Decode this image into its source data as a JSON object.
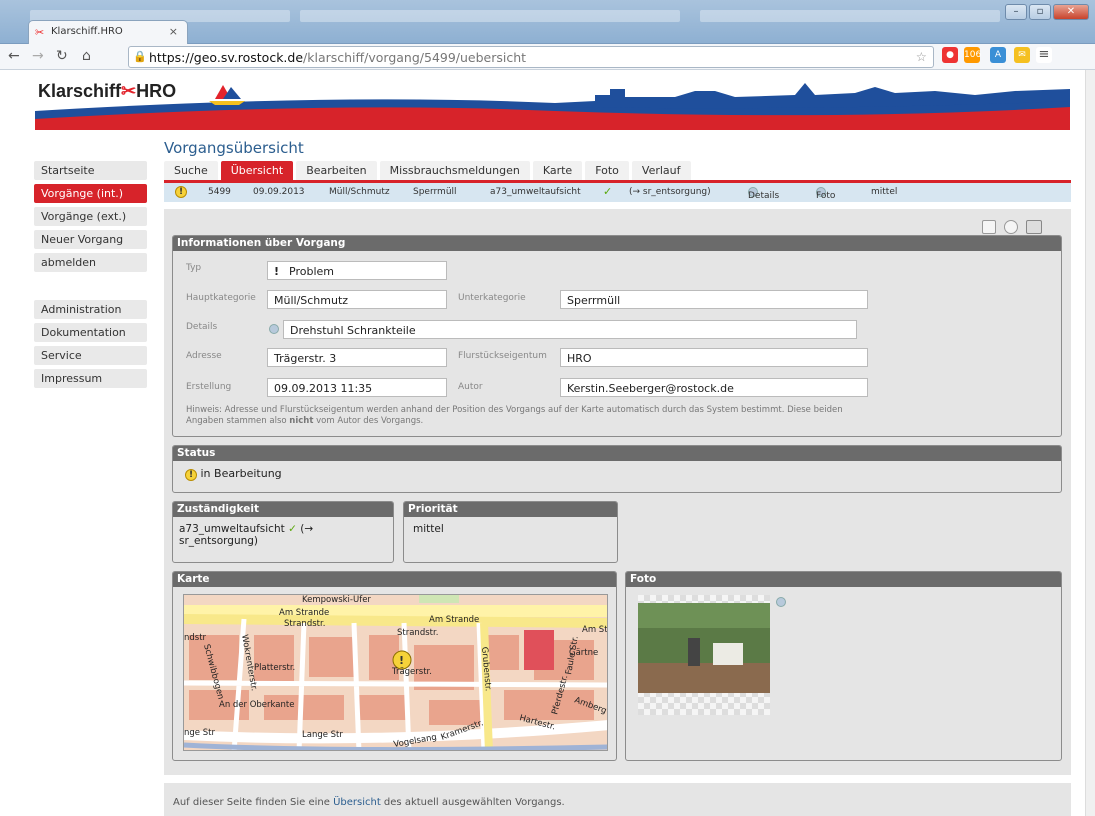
{
  "browser": {
    "tab_title": "Klarschiff.HRO",
    "tab_close": "×",
    "url_host": "https://geo.sv.rostock.de",
    "url_path": "/klarschiff/vorgang/5499/uebersicht",
    "ext_badge": "106"
  },
  "site": {
    "logo_a": "Klarschiff",
    "logo_b": "HRO",
    "page_title": "Vorgangsübersicht"
  },
  "sidebar": {
    "items": [
      {
        "label": "Startseite"
      },
      {
        "label": "Vorgänge (int.)"
      },
      {
        "label": "Vorgänge (ext.)"
      },
      {
        "label": "Neuer Vorgang"
      },
      {
        "label": "abmelden"
      },
      {
        "label": "Administration"
      },
      {
        "label": "Dokumentation"
      },
      {
        "label": "Service"
      },
      {
        "label": "Impressum"
      }
    ]
  },
  "tabs": [
    {
      "label": "Suche"
    },
    {
      "label": "Übersicht"
    },
    {
      "label": "Bearbeiten"
    },
    {
      "label": "Missbrauchsmeldungen"
    },
    {
      "label": "Karte"
    },
    {
      "label": "Foto"
    },
    {
      "label": "Verlauf"
    }
  ],
  "infobar": {
    "id": "5499",
    "date": "09.09.2013",
    "category": "Müll/Schmutz",
    "subcategory": "Sperrmüll",
    "responsible": "a73_umweltaufsicht",
    "check": "✓",
    "forward": "(→ sr_entsorgung)",
    "details": "Details",
    "foto": "Foto",
    "priority": "mittel"
  },
  "info": {
    "header": "Informationen über Vorgang",
    "typ_label": "Typ",
    "typ_value": "Problem",
    "hauptkategorie_label": "Hauptkategorie",
    "hauptkategorie_value": "Müll/Schmutz",
    "unterkategorie_label": "Unterkategorie",
    "unterkategorie_value": "Sperrmüll",
    "details_label": "Details",
    "details_value": "Drehstuhl Schrankteile",
    "adresse_label": "Adresse",
    "adresse_value": "Trägerstr. 3",
    "flurstueck_label": "Flurstückseigentum",
    "flurstueck_value": "HRO",
    "erstellung_label": "Erstellung",
    "erstellung_value": "09.09.2013 11:35",
    "autor_label": "Autor",
    "autor_value": "Kerstin.Seeberger@rostock.de",
    "hint_a": "Hinweis: Adresse und Flurstückseigentum werden anhand der Position des Vorgangs auf der Karte automatisch durch das System bestimmt. Diese beiden Angaben stammen also ",
    "hint_bold": "nicht",
    "hint_b": " vom Autor des Vorgangs."
  },
  "status": {
    "header": "Status",
    "value": "in Bearbeitung"
  },
  "zustaendigkeit": {
    "header": "Zuständigkeit",
    "value_a": "a73_umweltaufsicht",
    "check": "✓",
    "value_b": "(→ sr_entsorgung)"
  },
  "prioritaet": {
    "header": "Priorität",
    "value": "mittel"
  },
  "karte": {
    "header": "Karte",
    "streets": [
      "Kempowski-Ufer",
      "Am Strande",
      "Strandstr.",
      "Am Strande",
      "Am St",
      "Strandstr.",
      "ndstr",
      "Schwibbogen",
      "Wokrenterstr.",
      "Platterstr.",
      "Trägerstr.",
      "Grubenstr.",
      "Gärtne",
      "Faule Str.",
      "Pferdestr.",
      "Amberg",
      "An der Oberkante",
      "Hartestr.",
      "Kramerstr.",
      "nge Str",
      "Lange Str",
      "Vogelsang"
    ]
  },
  "foto": {
    "header": "Foto"
  },
  "footer": {
    "text_a": "Auf dieser Seite finden Sie eine ",
    "link": "Übersicht",
    "text_b": " des aktuell ausgewählten Vorgangs."
  },
  "colors": {
    "accent_red": "#d7232a",
    "title_blue": "#2c5e8f",
    "box_header": "#6b6b6b",
    "info_bar": "#d7e6f1"
  }
}
